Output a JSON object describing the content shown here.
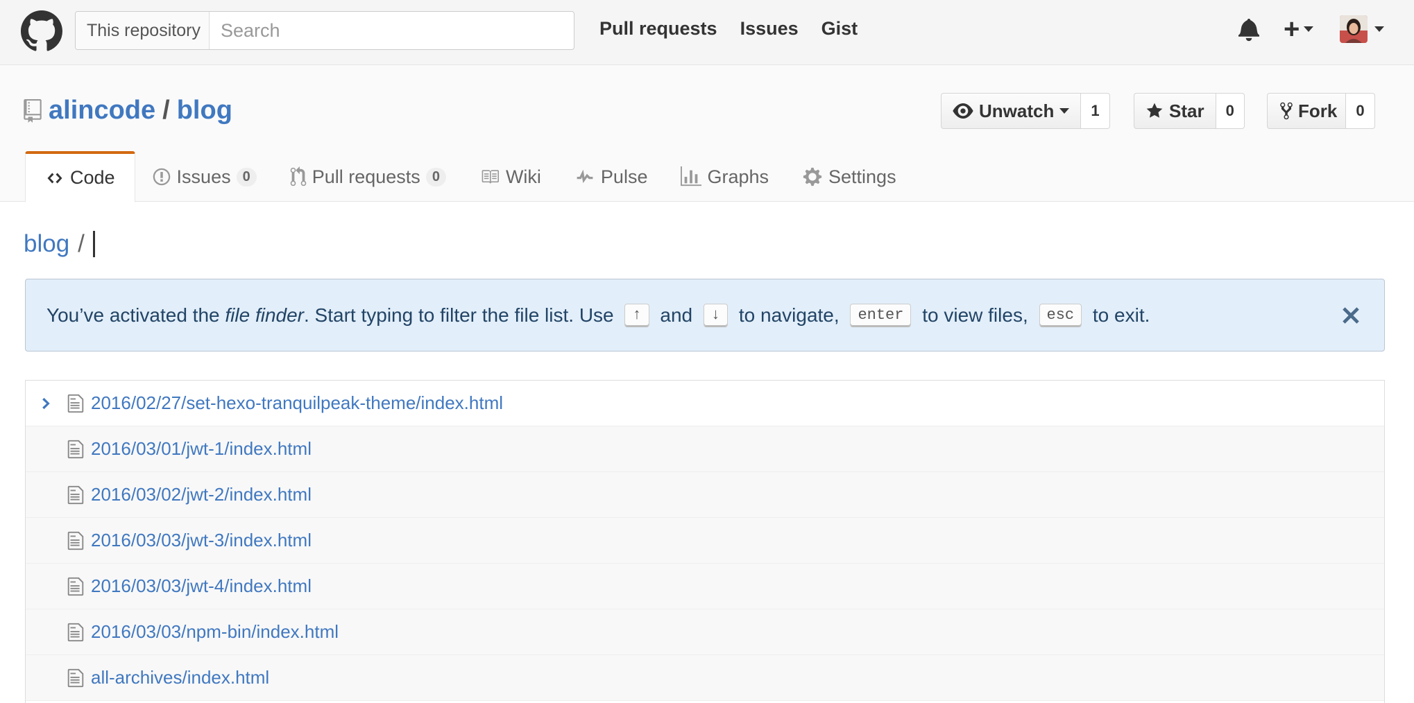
{
  "header": {
    "logo_icon": "github-octocat-icon",
    "search_scope": "This repository",
    "search_placeholder": "Search",
    "nav": [
      "Pull requests",
      "Issues",
      "Gist"
    ],
    "notifications_icon": "bell-icon",
    "create_icon": "plus-icon",
    "avatar_icon": "user-avatar"
  },
  "repo": {
    "owner": "alincode",
    "separator": "/",
    "name": "blog",
    "actions": {
      "watch_label": "Unwatch",
      "watch_count": "1",
      "star_label": "Star",
      "star_count": "0",
      "fork_label": "Fork",
      "fork_count": "0"
    },
    "tabs": [
      {
        "label": "Code",
        "icon": "code-icon",
        "selected": true
      },
      {
        "label": "Issues",
        "icon": "issue-opened-icon",
        "count": "0"
      },
      {
        "label": "Pull requests",
        "icon": "git-pull-request-icon",
        "count": "0"
      },
      {
        "label": "Wiki",
        "icon": "book-icon"
      },
      {
        "label": "Pulse",
        "icon": "pulse-icon"
      },
      {
        "label": "Graphs",
        "icon": "graph-icon"
      },
      {
        "label": "Settings",
        "icon": "gear-icon"
      }
    ]
  },
  "breadcrumb": {
    "repo": "blog",
    "separator": "/"
  },
  "flash": {
    "text_1": "You’ve activated the ",
    "text_em": "file finder",
    "text_2": ". Start typing to filter the file list. Use ",
    "key_up": "↑",
    "text_3": " and ",
    "key_down": "↓",
    "text_4": " to navigate, ",
    "key_enter": "enter",
    "text_5": " to view files, ",
    "key_esc": "esc",
    "text_6": " to exit.",
    "close_icon": "x-icon"
  },
  "files": [
    "2016/02/27/set-hexo-tranquilpeak-theme/index.html",
    "2016/03/01/jwt-1/index.html",
    "2016/03/02/jwt-2/index.html",
    "2016/03/03/jwt-3/index.html",
    "2016/03/03/jwt-4/index.html",
    "2016/03/03/npm-bin/index.html",
    "all-archives/index.html"
  ],
  "colors": {
    "link": "#4078c0",
    "selected_tab_accent": "#d26911",
    "flash_bg": "#e2eef9"
  }
}
